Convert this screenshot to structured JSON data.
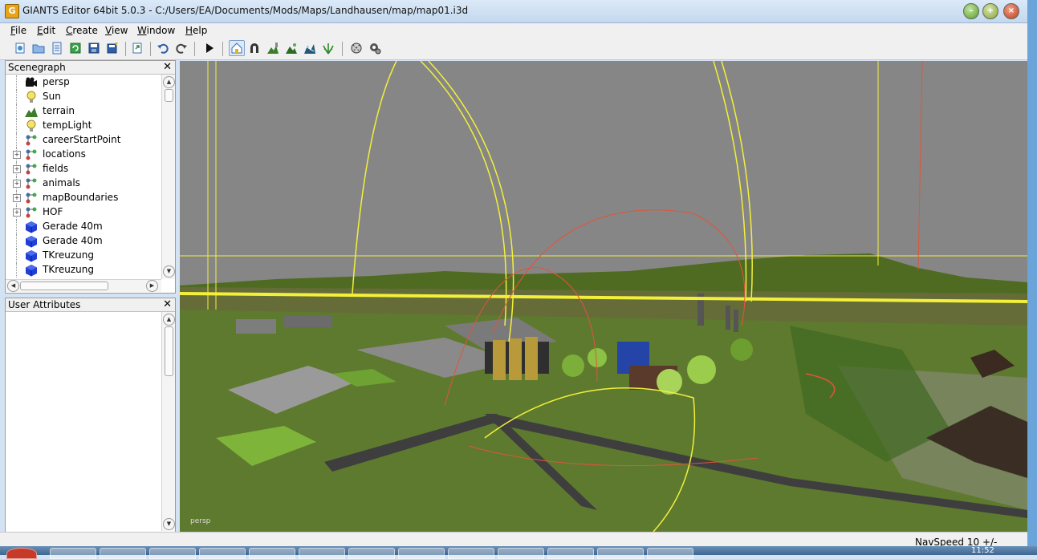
{
  "window": {
    "title": "GIANTS Editor 64bit 5.0.3 - C:/Users/EA/Documents/Mods/Maps/Landhausen/map/map01.i3d",
    "app_icon_letter": "G"
  },
  "menu": [
    "File",
    "Edit",
    "Create",
    "View",
    "Window",
    "Help"
  ],
  "toolbar": {
    "buttons": [
      "new-scene-icon",
      "open-file-icon",
      "import-icon",
      "reload-icon",
      "save-icon",
      "save-as-icon",
      "export-icon",
      "undo-icon",
      "redo-icon",
      "play-icon",
      "home-icon",
      "magnet-icon",
      "terrain-sculpt-icon",
      "terrain-paint-icon",
      "terrain-foliage-icon",
      "foliage-brush-icon",
      "texture-paint-icon",
      "settings-icon"
    ]
  },
  "scenegraph": {
    "title": "Scenegraph",
    "close": "✕",
    "items": [
      {
        "label": "persp",
        "icon": "camera-icon",
        "expandable": false
      },
      {
        "label": "Sun",
        "icon": "light-bulb-icon",
        "expandable": false
      },
      {
        "label": "terrain",
        "icon": "terrain-icon",
        "expandable": false
      },
      {
        "label": "tempLight",
        "icon": "light-bulb-icon",
        "expandable": false
      },
      {
        "label": "careerStartPoint",
        "icon": "transform-group-icon",
        "expandable": false
      },
      {
        "label": "locations",
        "icon": "transform-group-icon",
        "expandable": true
      },
      {
        "label": "fields",
        "icon": "transform-group-icon",
        "expandable": true
      },
      {
        "label": "animals",
        "icon": "transform-group-icon",
        "expandable": true
      },
      {
        "label": "mapBoundaries",
        "icon": "transform-group-icon",
        "expandable": true
      },
      {
        "label": "HOF",
        "icon": "transform-group-icon",
        "expandable": true
      },
      {
        "label": "Gerade 40m",
        "icon": "shape-cube-icon",
        "expandable": false
      },
      {
        "label": "Gerade 40m",
        "icon": "shape-cube-icon",
        "expandable": false
      },
      {
        "label": "TKreuzung",
        "icon": "shape-cube-icon",
        "expandable": false
      },
      {
        "label": "TKreuzung",
        "icon": "shape-cube-icon",
        "expandable": false
      }
    ]
  },
  "attributes": {
    "title": "User Attributes",
    "close": "✕"
  },
  "viewport": {
    "camera_label": "persp"
  },
  "status": {
    "navspeed": "NavSpeed 10 +/-"
  },
  "taskbar": {
    "clock": "11:52"
  },
  "colors": {
    "sky": "#868686",
    "grass": "#5e7a2e",
    "hill": "#4f6b22",
    "road": "#3e3e3e",
    "gizmo_yellow": "#f2f03a",
    "gizmo_red": "#e0553a"
  }
}
